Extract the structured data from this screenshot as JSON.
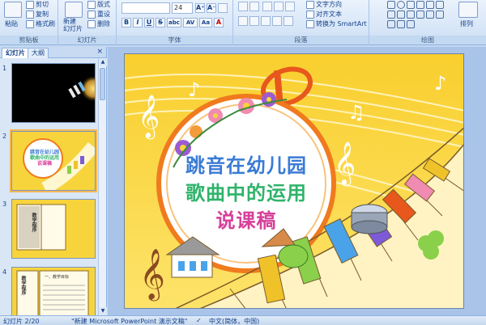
{
  "ribbon": {
    "clipboard": {
      "paste": "粘贴",
      "cut": "剪切",
      "copy": "复制",
      "format_painter": "格式刷",
      "label": "剪贴板"
    },
    "slides": {
      "new_slide": "新建\n幻灯片",
      "layout": "版式",
      "reset": "重设",
      "delete": "删除",
      "label": "幻灯片"
    },
    "font": {
      "font_size": "24",
      "grow": "A⁺",
      "shrink": "A⁻",
      "bold": "B",
      "italic": "I",
      "underline": "U",
      "strike": "S",
      "shadow": "abc",
      "spacing": "AV",
      "case": "Aa",
      "color": "A",
      "label": "字体"
    },
    "paragraph": {
      "text_direction": "文字方向",
      "align_text": "对齐文本",
      "convert_smartart": "转换为 SmartArt",
      "label": "段落"
    },
    "drawing": {
      "arrange": "排列",
      "label": "绘图"
    }
  },
  "left_pane": {
    "tabs": [
      "幻灯片",
      "大纲"
    ],
    "close": "×",
    "slides": [
      {
        "number": "1"
      },
      {
        "number": "2",
        "title_lines": [
          "跳音在幼儿园",
          "歌曲中的运用",
          "说课稿"
        ]
      },
      {
        "number": "3",
        "book_left": "教学程序"
      },
      {
        "number": "4",
        "doc_left": "教学程序",
        "doc_right": "一、教学目标"
      }
    ]
  },
  "slide": {
    "title_line1": "跳音在幼儿园",
    "title_line2": "歌曲中的运用",
    "title_line3": "说课稿"
  },
  "status": {
    "slide_info": "幻灯片 2/20",
    "theme": "\"新建 Microsoft PowerPoint 演示文稿\"",
    "language": "中文(简体，中国)"
  },
  "colors": {
    "accent": "#15428b",
    "slide_bg": "#f7d43c"
  }
}
